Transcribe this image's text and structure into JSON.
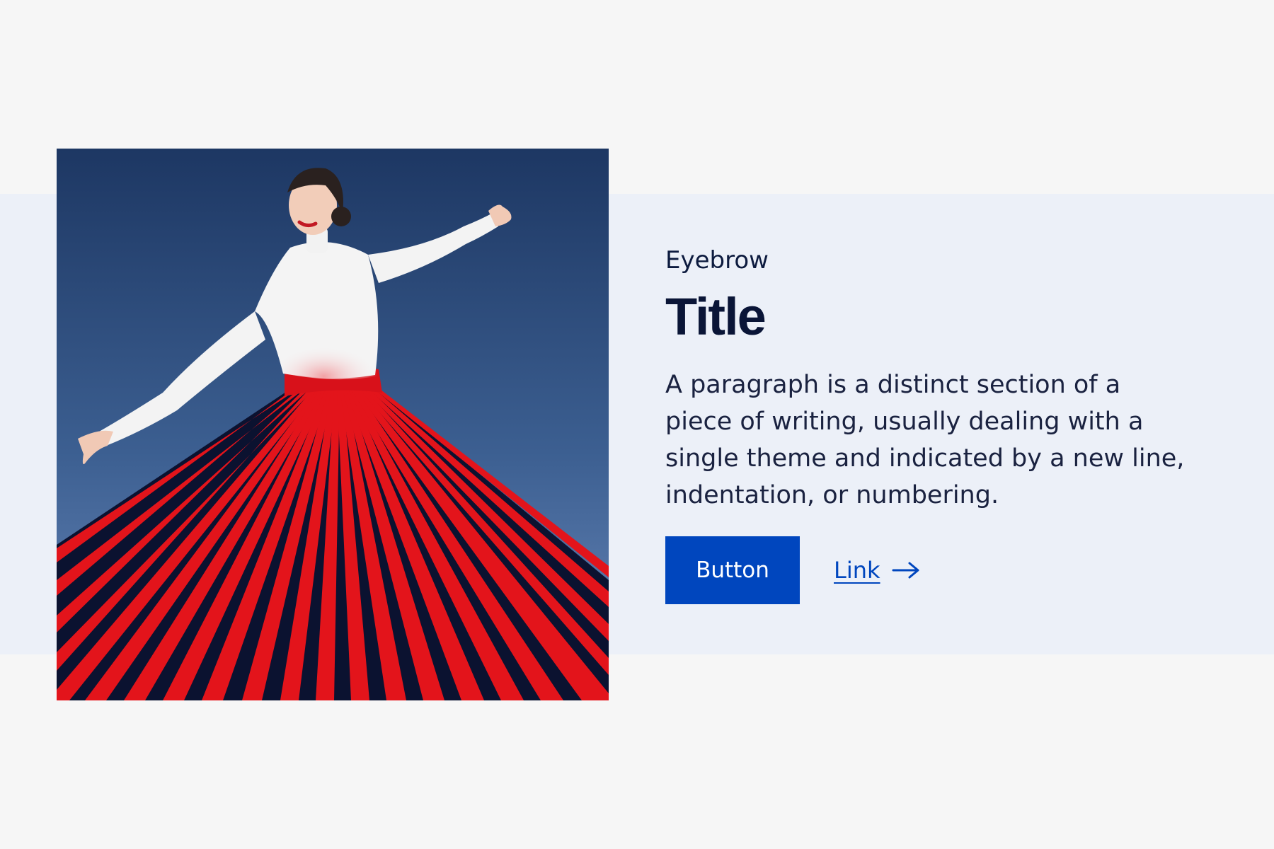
{
  "hero": {
    "image": {
      "alt": "",
      "description": ""
    },
    "eyebrow": "Eyebrow",
    "title": "Title",
    "paragraph": "A paragraph is a distinct section of a piece of writing, usually dealing with a single theme and indicated by a new line, indentation, or numbering.",
    "button_label": "Button",
    "link_label": "Link",
    "link_icon": "arrow-right-icon"
  },
  "colors": {
    "page_background": "#f6f6f6",
    "band_background": "#ecf0f8",
    "primary": "#0046be",
    "heading": "#0a1537",
    "text": "#1a2240"
  }
}
